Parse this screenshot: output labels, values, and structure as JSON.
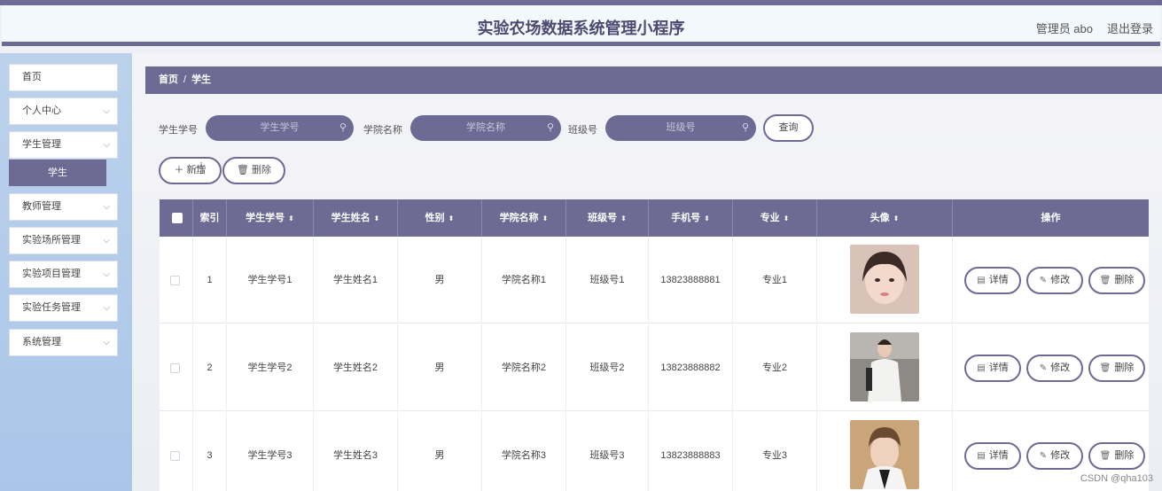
{
  "header": {
    "title": "实验农场数据系统管理小程序",
    "admin": "管理员 abo",
    "logout": "退出登录"
  },
  "sidebar": {
    "items": [
      {
        "label": "首页"
      },
      {
        "label": "个人中心"
      },
      {
        "label": "学生管理"
      },
      {
        "label": "教师管理"
      },
      {
        "label": "实验场所管理"
      },
      {
        "label": "实验项目管理"
      },
      {
        "label": "实验任务管理"
      },
      {
        "label": "系统管理"
      }
    ],
    "submenu": {
      "label": "学生"
    }
  },
  "breadcrumb": {
    "home": "首页",
    "sep": "/",
    "current": "学生"
  },
  "search": {
    "student_no_label": "学生学号",
    "student_no_placeholder": "学生学号",
    "college_label": "学院名称",
    "college_placeholder": "学院名称",
    "class_label": "班级号",
    "class_placeholder": "班级号",
    "query": "查询"
  },
  "toolbar": {
    "add": "新增",
    "delete": "删除"
  },
  "table": {
    "columns": [
      "索引",
      "学生学号",
      "学生姓名",
      "性别",
      "学院名称",
      "班级号",
      "手机号",
      "专业",
      "头像",
      "操作"
    ],
    "rows": [
      {
        "index": "1",
        "student_no": "学生学号1",
        "name": "学生姓名1",
        "gender": "男",
        "college": "学院名称1",
        "class_no": "班级号1",
        "phone": "13823888881",
        "major": "专业1"
      },
      {
        "index": "2",
        "student_no": "学生学号2",
        "name": "学生姓名2",
        "gender": "男",
        "college": "学院名称2",
        "class_no": "班级号2",
        "phone": "13823888882",
        "major": "专业2"
      },
      {
        "index": "3",
        "student_no": "学生学号3",
        "name": "学生姓名3",
        "gender": "男",
        "college": "学院名称3",
        "class_no": "班级号3",
        "phone": "13823888883",
        "major": "专业3"
      }
    ],
    "actions": {
      "detail": "详情",
      "edit": "修改",
      "delete": "删除"
    }
  },
  "watermark": "CSDN @qha103",
  "colors": {
    "accent": "#6d6a93",
    "sidebar": "#bcd2ec"
  }
}
